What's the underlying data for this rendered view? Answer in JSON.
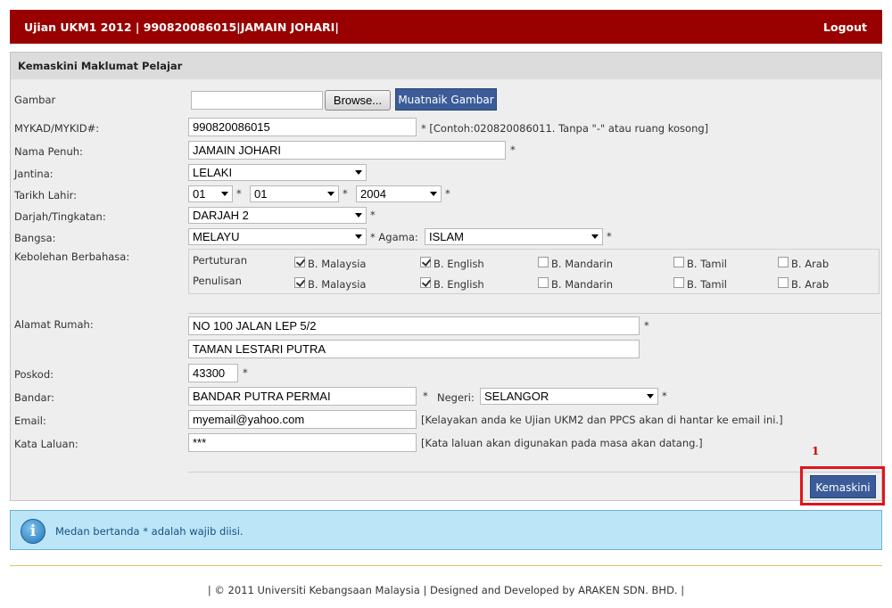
{
  "header": {
    "title": "Ujian UKM1 2012   |  990820086015|JAMAIN JOHARI|",
    "logout": "Logout"
  },
  "panel": {
    "title": "Kemaskini Maklumat Pelajar"
  },
  "form": {
    "gambar": {
      "label": "Gambar",
      "file_value": "",
      "browse": "Browse...",
      "upload": "Muatnaik Gambar"
    },
    "mykad": {
      "label": "MYKAD/MYKID#:",
      "value": "990820086015",
      "hint": "* [Contoh:020820086011. Tanpa \"-\" atau ruang kosong]"
    },
    "nama": {
      "label": "Nama Penuh:",
      "value": "JAMAIN JOHARI"
    },
    "jantina": {
      "label": "Jantina:",
      "value": "LELAKI"
    },
    "tarikh_lahir": {
      "label": "Tarikh Lahir:",
      "day": "01",
      "month": "01",
      "year": "2004"
    },
    "darjah": {
      "label": "Darjah/Tingkatan:",
      "value": "DARJAH 2"
    },
    "bangsa": {
      "label": "Bangsa:",
      "value": "MELAYU"
    },
    "agama": {
      "label": "* Agama:",
      "value": "ISLAM"
    },
    "kebolehan": {
      "label": "Kebolehan Berbahasa:",
      "rows": [
        {
          "label": "Pertuturan",
          "options": [
            {
              "label": "B. Malaysia",
              "checked": true
            },
            {
              "label": "B. English",
              "checked": true
            },
            {
              "label": "B. Mandarin",
              "checked": false
            },
            {
              "label": "B. Tamil",
              "checked": false
            },
            {
              "label": "B. Arab",
              "checked": false
            }
          ]
        },
        {
          "label": "Penulisan",
          "options": [
            {
              "label": "B. Malaysia",
              "checked": true
            },
            {
              "label": "B. English",
              "checked": true
            },
            {
              "label": "B. Mandarin",
              "checked": false
            },
            {
              "label": "B. Tamil",
              "checked": false
            },
            {
              "label": "B. Arab",
              "checked": false
            }
          ]
        }
      ]
    },
    "alamat": {
      "label": "Alamat Rumah:",
      "line1": "NO 100 JALAN LEP 5/2",
      "line2": "TAMAN LESTARI PUTRA"
    },
    "poskod": {
      "label": "Poskod:",
      "value": "43300"
    },
    "bandar": {
      "label": "Bandar:",
      "value": "BANDAR PUTRA PERMAI"
    },
    "negeri": {
      "label": "Negeri:",
      "value": "SELANGOR"
    },
    "email": {
      "label": "Email:",
      "value": "myemail@yahoo.com",
      "hint": "[Kelayakan anda ke Ujian UKM2 dan PPCS akan di hantar ke email ini.]"
    },
    "kata_laluan": {
      "label": "Kata Laluan:",
      "value": "***",
      "hint": "[Kata laluan akan digunakan pada masa akan datang.]"
    },
    "required": "*",
    "submit": "Kemaskini",
    "marker": "1"
  },
  "info": {
    "icon": "info-icon",
    "text": "Medan bertanda * adalah wajib diisi."
  },
  "footer": {
    "text": "| © 2011 Universiti Kebangsaan Malaysia | Designed and Developed by ARAKEN SDN. BHD. |"
  },
  "colors": {
    "header_bg": "#990000",
    "button_bg": "#3b5c98",
    "info_bg": "#bde5f8",
    "highlight": "#e0141b"
  }
}
